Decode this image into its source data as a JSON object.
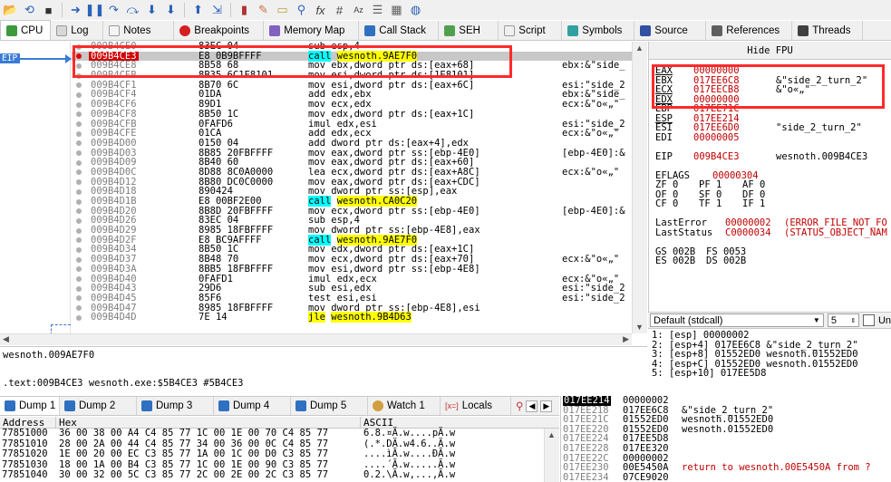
{
  "toolbar": {
    "icons": [
      "open-icon",
      "restart-icon",
      "close-icon",
      "run-icon",
      "pause-icon",
      "step-into-icon",
      "step-over-icon",
      "execute-till-return-icon",
      "run-to-user-code-icon",
      "trace-record-icon",
      "patch-icon",
      "comment-icon",
      "label-icon",
      "bookmark-icon",
      "function-icon",
      "hash-icon",
      "font-icon",
      "list-icon",
      "calculator-icon",
      "globe-icon"
    ],
    "fx": "fx",
    "hash": "#",
    "az": "Az"
  },
  "tabs": [
    {
      "label": "CPU",
      "color": "#3c9a3c"
    },
    {
      "label": "Log",
      "color": "#d0d0d0"
    },
    {
      "label": "Notes",
      "color": "#e8e8e8"
    },
    {
      "label": "Breakpoints",
      "color": "#d42020"
    },
    {
      "label": "Memory Map",
      "color": "#8060c0"
    },
    {
      "label": "Call Stack",
      "color": "#3070c0"
    },
    {
      "label": "SEH",
      "color": "#50a050"
    },
    {
      "label": "Script",
      "color": "#f0f0f0"
    },
    {
      "label": "Symbols",
      "color": "#30a0a0"
    },
    {
      "label": "Source",
      "color": "#3050a0"
    },
    {
      "label": "References",
      "color": "#606060"
    },
    {
      "label": "Threads",
      "color": "#404040"
    }
  ],
  "eip_label": "EIP",
  "disasm": [
    {
      "addr": "009B4CE0",
      "bytes": "83EC 04",
      "asm": "sub esp,4",
      "cmt": ""
    },
    {
      "addr": "009B4CE3",
      "bytes": "E8 0B9BFFFF",
      "asm": "call",
      "target": "wesnoth.9AE7F0",
      "cmt": "",
      "current": true
    },
    {
      "addr": "009B4CE8",
      "bytes": "8B58 68",
      "asm": "mov ebx,dword ptr ds:[eax+68]",
      "cmt": "ebx:&\"side_"
    },
    {
      "addr": "009B4CEB",
      "bytes": "8B35 6C1E8101",
      "asm": "mov esi,dword ptr ds:[1E8101]",
      "cmt": ""
    },
    {
      "addr": "009B4CF1",
      "bytes": "8B70 6C",
      "asm": "mov esi,dword ptr ds:[eax+6C]",
      "cmt": "esi:\"side_2"
    },
    {
      "addr": "009B4CF4",
      "bytes": "01DA",
      "asm": "add edx,ebx",
      "cmt": "ebx:&\"side_"
    },
    {
      "addr": "009B4CF6",
      "bytes": "89D1",
      "asm": "mov ecx,edx",
      "cmt": "ecx:&\"o«„\""
    },
    {
      "addr": "009B4CF8",
      "bytes": "8B50 1C",
      "asm": "mov edx,dword ptr ds:[eax+1C]",
      "cmt": ""
    },
    {
      "addr": "009B4CFB",
      "bytes": "0FAFD6",
      "asm": "imul edx,esi",
      "cmt": "esi:\"side_2"
    },
    {
      "addr": "009B4CFE",
      "bytes": "01CA",
      "asm": "add edx,ecx",
      "cmt": "ecx:&\"o«„\""
    },
    {
      "addr": "009B4D00",
      "bytes": "0150 04",
      "asm": "add dword ptr ds:[eax+4],edx",
      "cmt": ""
    },
    {
      "addr": "009B4D03",
      "bytes": "8B85 20FBFFFF",
      "asm": "mov eax,dword ptr ss:[ebp-4E0]",
      "cmt": "[ebp-4E0]:&"
    },
    {
      "addr": "009B4D09",
      "bytes": "8B40 60",
      "asm": "mov eax,dword ptr ds:[eax+60]",
      "cmt": ""
    },
    {
      "addr": "009B4D0C",
      "bytes": "8D88 8C0A0000",
      "asm": "lea ecx,dword ptr ds:[eax+A8C]",
      "cmt": "ecx:&\"o«„\""
    },
    {
      "addr": "009B4D12",
      "bytes": "8B80 DC0C0000",
      "asm": "mov eax,dword ptr ds:[eax+CDC]",
      "cmt": ""
    },
    {
      "addr": "009B4D18",
      "bytes": "890424",
      "asm": "mov dword ptr ss:[esp],eax",
      "cmt": ""
    },
    {
      "addr": "009B4D1B",
      "bytes": "E8 00BF2E00",
      "asm": "call",
      "target": "wesnoth.CA0C20",
      "cmt": ""
    },
    {
      "addr": "009B4D20",
      "bytes": "8B8D 20FBFFFF",
      "asm": "mov ecx,dword ptr ss:[ebp-4E0]",
      "cmt": "[ebp-4E0]:&"
    },
    {
      "addr": "009B4D26",
      "bytes": "83EC 04",
      "asm": "sub esp,4",
      "cmt": ""
    },
    {
      "addr": "009B4D29",
      "bytes": "8985 18FBFFFF",
      "asm": "mov dword ptr ss:[ebp-4E8],eax",
      "cmt": ""
    },
    {
      "addr": "009B4D2F",
      "bytes": "E8 BC9AFFFF",
      "asm": "call",
      "target": "wesnoth.9AE7F0",
      "cmt": ""
    },
    {
      "addr": "009B4D34",
      "bytes": "8B50 1C",
      "asm": "mov edx,dword ptr ds:[eax+1C]",
      "cmt": ""
    },
    {
      "addr": "009B4D37",
      "bytes": "8B48 70",
      "asm": "mov ecx,dword ptr ds:[eax+70]",
      "cmt": "ecx:&\"o«„\""
    },
    {
      "addr": "009B4D3A",
      "bytes": "8BB5 18FBFFFF",
      "asm": "mov esi,dword ptr ss:[ebp-4E8]",
      "cmt": ""
    },
    {
      "addr": "009B4D40",
      "bytes": "0FAFD1",
      "asm": "imul edx,ecx",
      "cmt": "ecx:&\"o«„\""
    },
    {
      "addr": "009B4D43",
      "bytes": "29D6",
      "asm": "sub esi,edx",
      "cmt": "esi:\"side_2"
    },
    {
      "addr": "009B4D45",
      "bytes": "85F6",
      "asm": "test esi,esi",
      "cmt": "esi:\"side_2"
    },
    {
      "addr": "009B4D47",
      "bytes": "8985 18FBFFFF",
      "asm": "mov dword ptr ss:[ebp-4E8],esi",
      "cmt": ""
    },
    {
      "addr": "009B4D4D",
      "bytes": "7E 14",
      "asm": "jle",
      "target": "wesnoth.9B4D63",
      "cmt": ""
    }
  ],
  "info_line1": "wesnoth.009AE7F0",
  "info_line2": ".text:009B4CE3 wesnoth.exe:$5B4CE3 #5B4CE3",
  "regs": {
    "hide_fpu": "Hide FPU",
    "rows": [
      {
        "n": "EAX",
        "v": "00000000",
        "c": ""
      },
      {
        "n": "EBX",
        "v": "017EE6C8",
        "c": "&\"side_2_turn_2\""
      },
      {
        "n": "ECX",
        "v": "017EECB8",
        "c": "&\"o«„\""
      },
      {
        "n": "EDX",
        "v": "00000000",
        "c": ""
      },
      {
        "n": "EBP",
        "v": "017EE71C",
        "c": ""
      },
      {
        "n": "ESP",
        "v": "017EE214",
        "c": ""
      },
      {
        "n": "ESI",
        "v": "017EE6D0",
        "c": "\"side_2_turn_2\""
      },
      {
        "n": "EDI",
        "v": "00000005",
        "c": ""
      },
      {
        "n": "",
        "v": "",
        "c": ""
      },
      {
        "n": "EIP",
        "v": "009B4CE3",
        "c": "wesnoth.009B4CE3"
      },
      {
        "n": "",
        "v": "",
        "c": ""
      },
      {
        "n": "EFLAGS",
        "v": "00000304",
        "c": ""
      },
      {
        "n": "ZF 0",
        "v": "PF 1",
        "c": "AF 0"
      },
      {
        "n": "OF 0",
        "v": "SF 0",
        "c": "DF 0"
      },
      {
        "n": "CF 0",
        "v": "TF 1",
        "c": "IF 1"
      },
      {
        "n": "",
        "v": "",
        "c": ""
      },
      {
        "n": "LastError",
        "v": "00000002",
        "c": "(ERROR_FILE_NOT_FO"
      },
      {
        "n": "LastStatus",
        "v": "C0000034",
        "c": "(STATUS_OBJECT_NAM"
      },
      {
        "n": "",
        "v": "",
        "c": ""
      },
      {
        "n": "GS 002B",
        "v": "FS 0053",
        "c": ""
      },
      {
        "n": "ES 002B",
        "v": "DS 002B",
        "c": ""
      }
    ]
  },
  "callconv": {
    "selected": "Default (stdcall)",
    "count": "5",
    "unlock": "Un"
  },
  "args": [
    "1: [esp] 00000002",
    "2: [esp+4] 017EE6C8 &\"side_2_turn_2\"",
    "3: [esp+8] 01552ED0 wesnoth.01552ED0",
    "4: [esp+C] 01552ED0 wesnoth.01552ED0",
    "5: [esp+10] 017EE5D8"
  ],
  "bottom_tabs": [
    {
      "label": "Dump 1",
      "active": true
    },
    {
      "label": "Dump 2"
    },
    {
      "label": "Dump 3"
    },
    {
      "label": "Dump 4"
    },
    {
      "label": "Dump 5"
    },
    {
      "label": "Watch 1"
    },
    {
      "label": "Locals"
    }
  ],
  "dump": {
    "headers": [
      "Address",
      "Hex",
      "ASCII"
    ],
    "rows": [
      {
        "addr": "77851000",
        "hex": "36 00 38 00  A4 C4 85 77  1C 00 1E 00  70 C4 85 77",
        "ascii": "6.8.¤Ä.w....pÄ.w"
      },
      {
        "addr": "77851010",
        "hex": "28 00 2A 00  44 C4 85 77  34 00 36 00  0C C4 85 77",
        "ascii": "(.*.DÄ.w4.6..Ä.w"
      },
      {
        "addr": "77851020",
        "hex": "1E 00 20 00  EC C3 85 77  1A 00 1C 00  D0 C3 85 77",
        "ascii": "....ìÃ.w....ÐÃ.w"
      },
      {
        "addr": "77851030",
        "hex": "18 00 1A 00  B4 C3 85 77  1C 00 1E 00  90 C3 85 77",
        "ascii": "....´Ã.w.....Ã.w"
      },
      {
        "addr": "77851040",
        "hex": "30 00 32 00  5C C3 85 77  2C 00 2E 00  2C C3 85 77",
        "ascii": "0.2.\\Ã.w,...,Ã.w"
      }
    ]
  },
  "stack": [
    {
      "addr": "017EE214",
      "val": "00000002",
      "cmt": "",
      "cur": true
    },
    {
      "addr": "017EE218",
      "val": "017EE6C8",
      "cmt": "&\"side_2_turn_2\""
    },
    {
      "addr": "017EE21C",
      "val": "01552ED0",
      "cmt": "wesnoth.01552ED0"
    },
    {
      "addr": "017EE220",
      "val": "01552ED0",
      "cmt": "wesnoth.01552ED0"
    },
    {
      "addr": "017EE224",
      "val": "017EE5D8",
      "cmt": ""
    },
    {
      "addr": "017EE228",
      "val": "017EE320",
      "cmt": ""
    },
    {
      "addr": "017EE22C",
      "val": "00000002",
      "cmt": ""
    },
    {
      "addr": "017EE230",
      "val": "00E5450A",
      "cmt": "return to wesnoth.00E5450A from ?",
      "red": true
    },
    {
      "addr": "017EE234",
      "val": "07CE9020",
      "cmt": ""
    }
  ]
}
